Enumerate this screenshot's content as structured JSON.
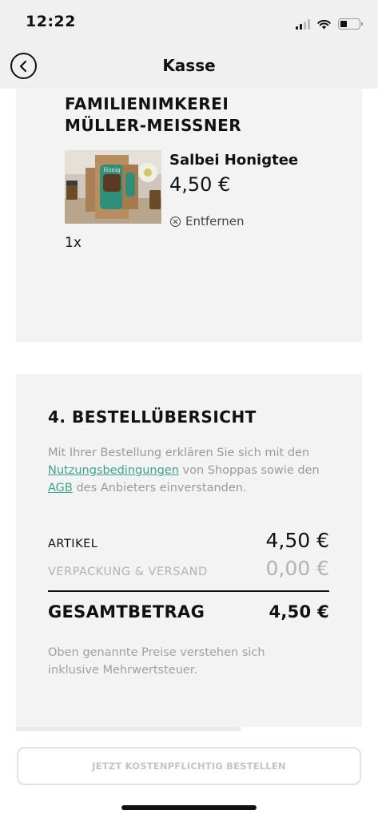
{
  "status_bar": {
    "time": "12:22"
  },
  "header": {
    "title": "Kasse",
    "back_icon": "chevron-left-icon"
  },
  "store": {
    "vendor_name": "FAMILIENIMKEREI MÜLLER-MEISSNER",
    "item": {
      "name": "Salbei Honigtee",
      "price": "4,50 €",
      "remove_label": "Entfernen",
      "quantity": "1x",
      "image_label": "Honig"
    }
  },
  "overview": {
    "title": "4. BESTELLÜBERSICHT",
    "terms": {
      "part1": "Mit Ihrer Bestellung erklären Sie sich mit den ",
      "link1": "Nutzungsbedingungen",
      "part2": " von Shoppas sowie den ",
      "link2": "AGB",
      "part3": " des Anbieters einverstanden."
    },
    "articles_label": "ARTIKEL",
    "articles_value": "4,50 €",
    "shipping_label": "VERPACKUNG & VERSAND",
    "shipping_value": "0,00 €",
    "total_label": "GESAMTBETRAG",
    "total_value": "4,50 €",
    "tax_note": "Oben genannte Preise verstehen sich inklusive Mehrwertsteuer."
  },
  "order_button": {
    "label": "JETZT KOSTENPFLICHTIG BESTELLEN"
  },
  "colors": {
    "link": "#3fa48c",
    "card_bg": "#f3f3f3",
    "header_bg": "#f0f0f0"
  }
}
